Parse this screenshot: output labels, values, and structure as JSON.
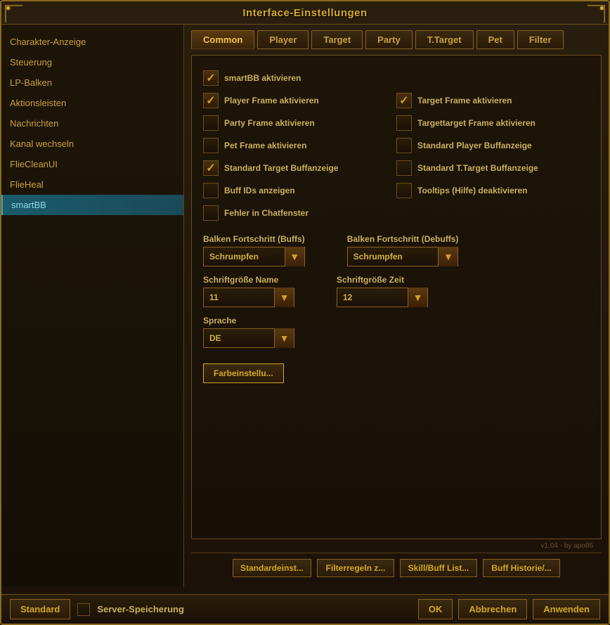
{
  "window": {
    "title": "Interface-Einstellungen"
  },
  "sidebar": {
    "items": [
      {
        "id": "charakter",
        "label": "Charakter-Anzeige",
        "active": false
      },
      {
        "id": "steuerung",
        "label": "Steuerung",
        "active": false
      },
      {
        "id": "lp-balken",
        "label": "LP-Balken",
        "active": false
      },
      {
        "id": "aktionsleisten",
        "label": "Aktionsleisten",
        "active": false
      },
      {
        "id": "nachrichten",
        "label": "Nachrichten",
        "active": false
      },
      {
        "id": "kanal",
        "label": "Kanal wechseln",
        "active": false
      },
      {
        "id": "fliecleanui",
        "label": "FlieCleanUI",
        "active": false
      },
      {
        "id": "flieheal",
        "label": "FlieHeal",
        "active": false
      },
      {
        "id": "smartbb",
        "label": "smartBB",
        "active": true
      }
    ]
  },
  "tabs": [
    {
      "id": "common",
      "label": "Common",
      "active": true
    },
    {
      "id": "player",
      "label": "Player",
      "active": false
    },
    {
      "id": "target",
      "label": "Target",
      "active": false
    },
    {
      "id": "party",
      "label": "Party",
      "active": false
    },
    {
      "id": "ttarget",
      "label": "T.Target",
      "active": false
    },
    {
      "id": "pet",
      "label": "Pet",
      "active": false
    },
    {
      "id": "filter",
      "label": "Filter",
      "active": false
    }
  ],
  "checkboxes": [
    {
      "id": "smartbb-aktivieren",
      "label": "smartBB aktivieren",
      "checked": true,
      "fullWidth": true,
      "col": 1
    },
    {
      "id": "player-frame",
      "label": "Player Frame aktivieren",
      "checked": true,
      "col": 1
    },
    {
      "id": "target-frame",
      "label": "Target Frame aktivieren",
      "checked": true,
      "col": 2
    },
    {
      "id": "party-frame",
      "label": "Party Frame aktivieren",
      "checked": false,
      "col": 1
    },
    {
      "id": "targettarget-frame",
      "label": "Targettarget Frame aktivieren",
      "checked": false,
      "col": 2
    },
    {
      "id": "pet-frame",
      "label": "Pet Frame aktivieren",
      "checked": false,
      "col": 1
    },
    {
      "id": "standard-player-buff",
      "label": "Standard Player Buffanzeige",
      "checked": false,
      "col": 2
    },
    {
      "id": "standard-target-buff",
      "label": "Standard Target Buffanzeige",
      "checked": true,
      "col": 1
    },
    {
      "id": "standard-ttarget-buff",
      "label": "Standard T.Target Buffanzeige",
      "checked": false,
      "col": 2
    },
    {
      "id": "buff-ids",
      "label": "Buff IDs anzeigen",
      "checked": false,
      "col": 1
    },
    {
      "id": "tooltips",
      "label": "Tooltips (Hilfe) deaktivieren",
      "checked": false,
      "col": 2
    },
    {
      "id": "fehler-chat",
      "label": "Fehler in Chatfenster",
      "checked": false,
      "col": 1,
      "fullWidth": false
    }
  ],
  "dropdowns": {
    "buffs_label": "Balken Fortschritt (Buffs)",
    "buffs_value": "Schrumpfen",
    "debuffs_label": "Balken Fortschritt (Debuffs)",
    "debuffs_value": "Schrumpfen",
    "name_label": "Schriftgröße Name",
    "name_value": "11",
    "zeit_label": "Schriftgröße Zeit",
    "zeit_value": "12",
    "sprache_label": "Sprache",
    "sprache_value": "DE"
  },
  "farb_button": "Farbeinstellu...",
  "bottom_buttons": [
    {
      "id": "standardeinst",
      "label": "Standardeinst..."
    },
    {
      "id": "filterregeln",
      "label": "Filterregeln z..."
    },
    {
      "id": "skillbuff",
      "label": "Skill/Buff List..."
    },
    {
      "id": "buffhistorie",
      "label": "Buff Historie/..."
    }
  ],
  "footer": {
    "standard_label": "Standard",
    "server_label": "Server-Speicherung",
    "ok_label": "OK",
    "abbrechen_label": "Abbrechen",
    "anwenden_label": "Anwenden"
  },
  "version": "v1.04 - by apo86"
}
